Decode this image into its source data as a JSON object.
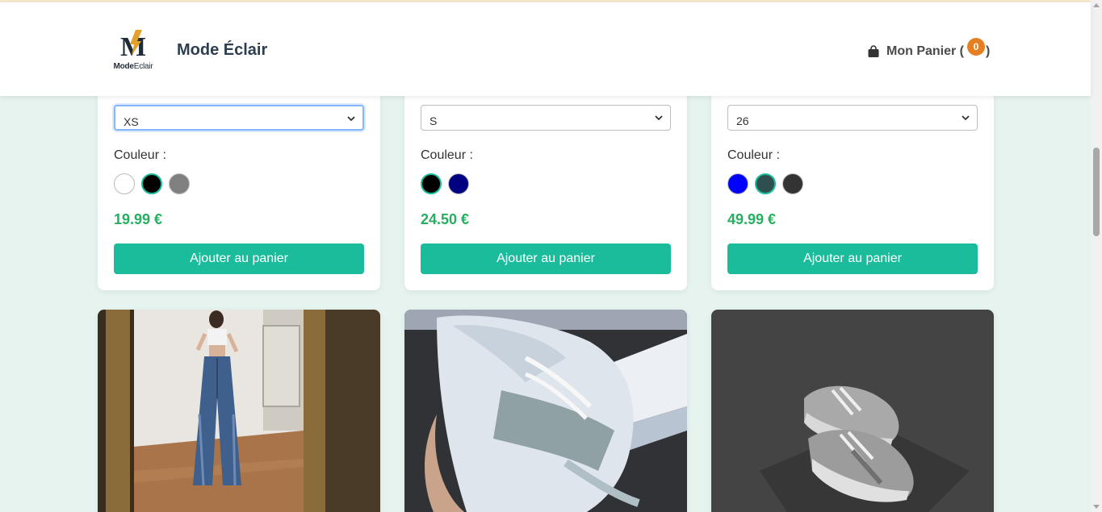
{
  "header": {
    "logo_text_bold": "Mode",
    "logo_text_light": "Eclair",
    "brand": "Mode Éclair",
    "cart_label": "Mon Panier (",
    "cart_count": "0",
    "cart_close": ")"
  },
  "products": [
    {
      "size_value": "XS",
      "color_label": "Couleur :",
      "colors": [
        "#ffffff",
        "#000000",
        "#808080"
      ],
      "selected_color": "#000000",
      "price": "19.99 €",
      "button": "Ajouter au panier"
    },
    {
      "size_value": "S",
      "color_label": "Couleur :",
      "colors": [
        "#000000",
        "#000080"
      ],
      "selected_color": "#000000",
      "price": "24.50 €",
      "button": "Ajouter au panier"
    },
    {
      "size_value": "26",
      "color_label": "Couleur :",
      "colors": [
        "#0000ff",
        "#2f4f4f",
        "#333333"
      ],
      "selected_color": "#2f4f4f",
      "price": "49.99 €",
      "button": "Ajouter au panier"
    }
  ],
  "images": [
    {
      "icon": "jeans-mirror-photo"
    },
    {
      "icon": "white-sneaker-photo"
    },
    {
      "icon": "grey-sneakers-photo"
    }
  ],
  "colors": {
    "accent": "#1abc9c",
    "price": "#27ae60",
    "badge": "#e67e22",
    "background": "#e6f3ef"
  }
}
